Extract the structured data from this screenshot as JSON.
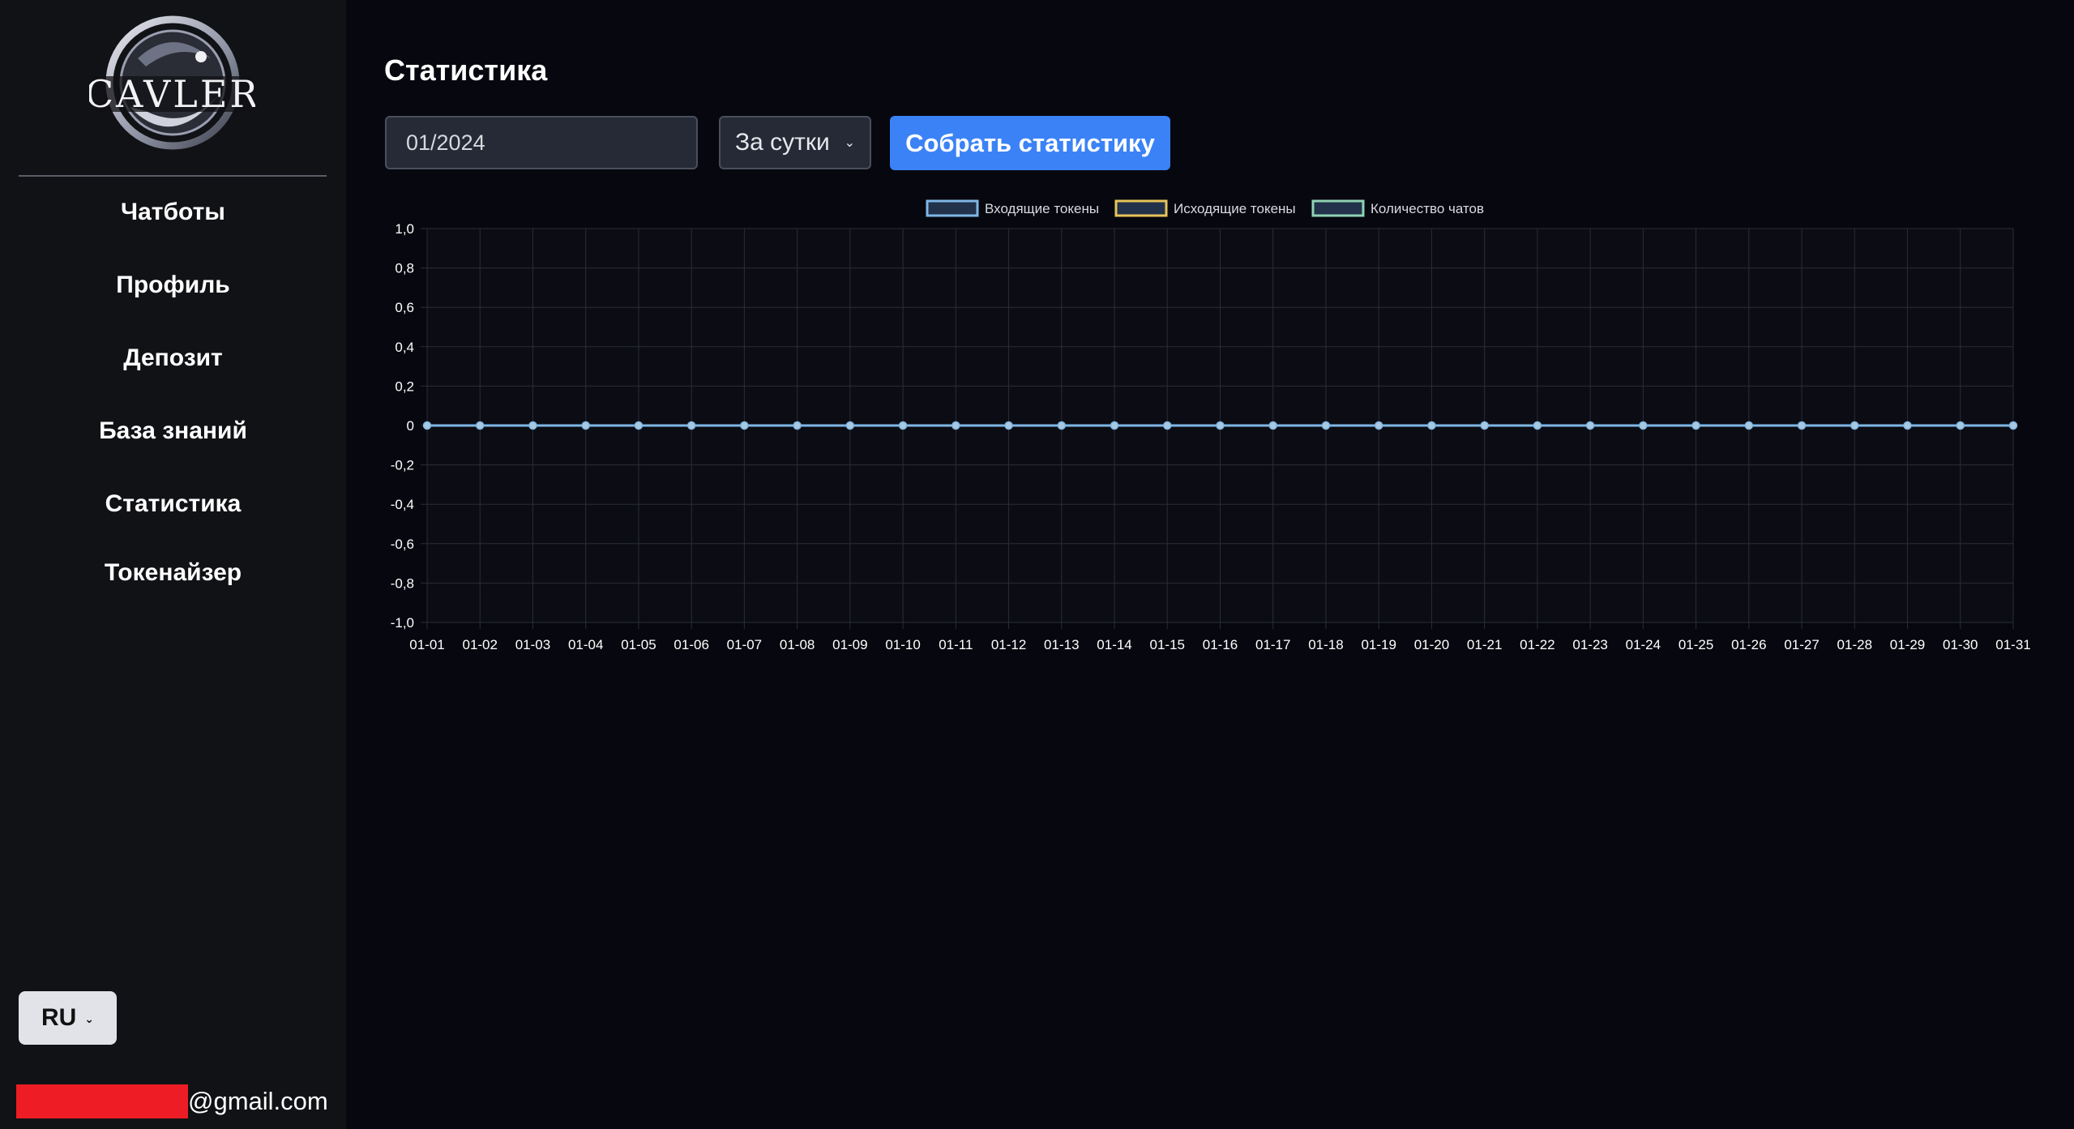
{
  "sidebar": {
    "logo_text": "CAVLER",
    "items": [
      {
        "label": "Чатботы"
      },
      {
        "label": "Профиль"
      },
      {
        "label": "Депозит"
      },
      {
        "label": "База знаний"
      },
      {
        "label": "Статистика"
      },
      {
        "label": "Токенайзер"
      }
    ],
    "language": "RU",
    "user_email_suffix": "@gmail.com"
  },
  "main": {
    "title": "Статистика",
    "month_value": "01/2024",
    "period_selected": "За сутки",
    "collect_label": "Собрать статистику"
  },
  "colors": {
    "accent": "#3b82f6",
    "incoming": "#7fb7e6",
    "outgoing": "#e8c35a",
    "chats": "#8fd3b5"
  },
  "chart_data": {
    "type": "line",
    "legend_position": "top",
    "grid": true,
    "x": [
      "01-01",
      "01-02",
      "01-03",
      "01-04",
      "01-05",
      "01-06",
      "01-07",
      "01-08",
      "01-09",
      "01-10",
      "01-11",
      "01-12",
      "01-13",
      "01-14",
      "01-15",
      "01-16",
      "01-17",
      "01-18",
      "01-19",
      "01-20",
      "01-21",
      "01-22",
      "01-23",
      "01-24",
      "01-25",
      "01-26",
      "01-27",
      "01-28",
      "01-29",
      "01-30",
      "01-31"
    ],
    "ylim": [
      -1,
      1
    ],
    "yticks": [
      "1,0",
      "0,8",
      "0,6",
      "0,4",
      "0,2",
      "0",
      "-0,2",
      "-0,4",
      "-0,6",
      "-0,8",
      "-1,0"
    ],
    "series": [
      {
        "name": "Входящие токены",
        "color": "#7fb7e6",
        "values": [
          0,
          0,
          0,
          0,
          0,
          0,
          0,
          0,
          0,
          0,
          0,
          0,
          0,
          0,
          0,
          0,
          0,
          0,
          0,
          0,
          0,
          0,
          0,
          0,
          0,
          0,
          0,
          0,
          0,
          0,
          0
        ]
      },
      {
        "name": "Исходящие токены",
        "color": "#e8c35a",
        "values": [
          0,
          0,
          0,
          0,
          0,
          0,
          0,
          0,
          0,
          0,
          0,
          0,
          0,
          0,
          0,
          0,
          0,
          0,
          0,
          0,
          0,
          0,
          0,
          0,
          0,
          0,
          0,
          0,
          0,
          0,
          0
        ]
      },
      {
        "name": "Количество чатов",
        "color": "#8fd3b5",
        "values": [
          0,
          0,
          0,
          0,
          0,
          0,
          0,
          0,
          0,
          0,
          0,
          0,
          0,
          0,
          0,
          0,
          0,
          0,
          0,
          0,
          0,
          0,
          0,
          0,
          0,
          0,
          0,
          0,
          0,
          0,
          0
        ]
      }
    ]
  }
}
